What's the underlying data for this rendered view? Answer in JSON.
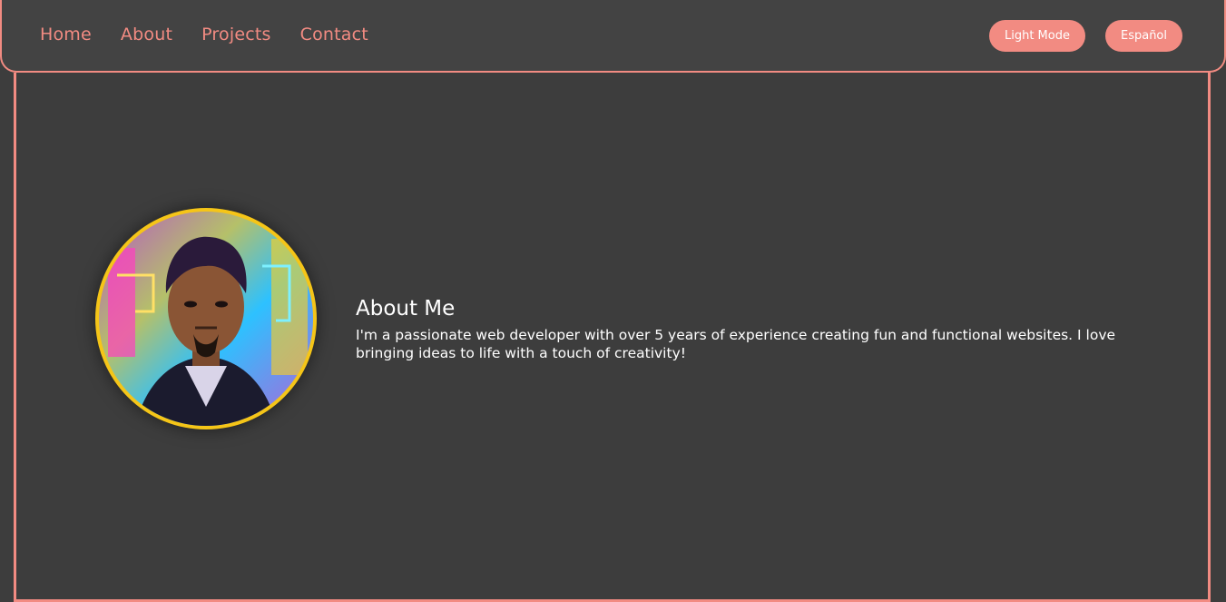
{
  "nav": {
    "links": [
      "Home",
      "About",
      "Projects",
      "Contact"
    ],
    "light_mode_label": "Light Mode",
    "language_label": "Español"
  },
  "about": {
    "title": "About Me",
    "text": "I'm a passionate web developer with over 5 years of experience creating fun and functional websites. I love bringing ideas to life with a touch of creativity!"
  },
  "colors": {
    "accent": "#f28b82",
    "background": "#3d3d3d",
    "avatar_ring": "#f5c518"
  },
  "icons": {
    "avatar": "profile-portrait"
  }
}
